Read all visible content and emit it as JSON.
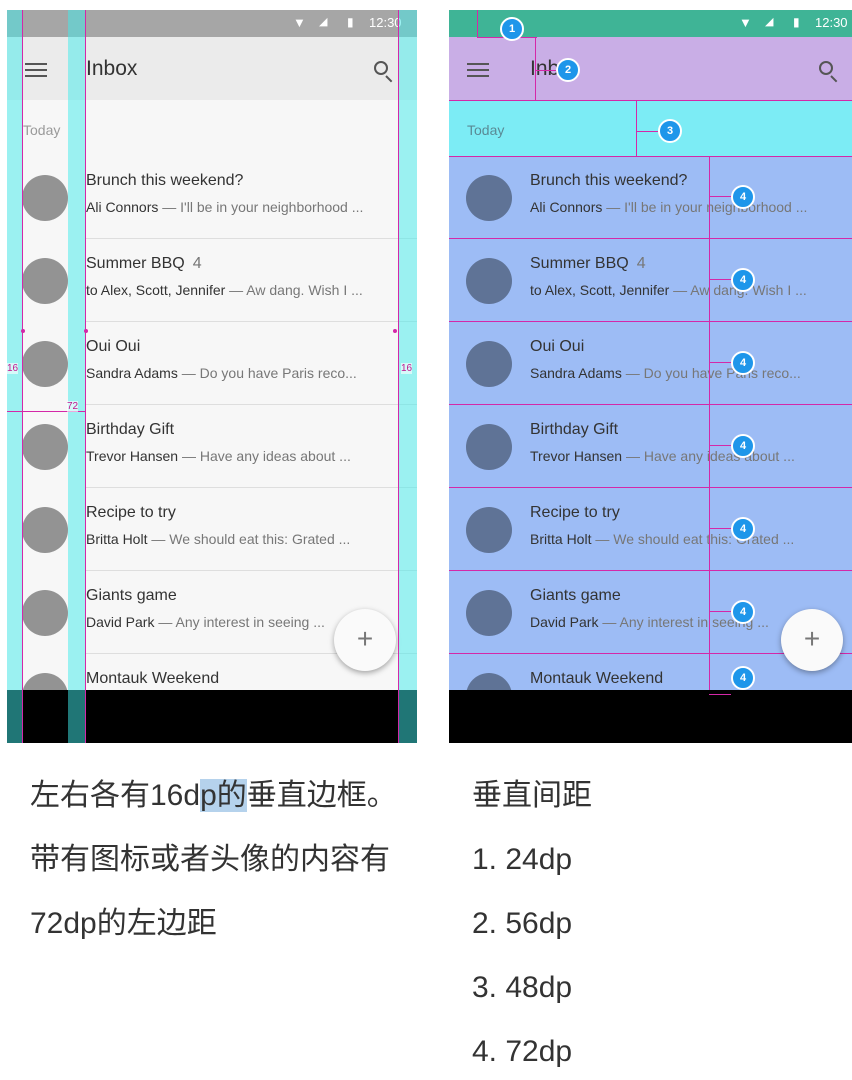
{
  "status": {
    "time": "12:30"
  },
  "appbar": {
    "title_left": "Inbox",
    "title_right": "Inb  x"
  },
  "section": {
    "today": "Today"
  },
  "emails": [
    {
      "subject": "Brunch this weekend?",
      "count": "",
      "sender": "Ali Connors",
      "snippet": " — I'll be in your neighborhood ..."
    },
    {
      "subject": "Summer BBQ",
      "count": "4",
      "sender": "to Alex, Scott, Jennifer",
      "snippet": " — Aw dang. Wish I ..."
    },
    {
      "subject": "Oui Oui",
      "count": "",
      "sender": "Sandra Adams",
      "snippet": " — Do you have Paris reco..."
    },
    {
      "subject": "Birthday Gift",
      "count": "",
      "sender": "Trevor Hansen",
      "snippet": " — Have any ideas about ..."
    },
    {
      "subject": "Recipe to try",
      "count": "",
      "sender": "Britta Holt",
      "snippet": " — We should eat this: Grated ..."
    },
    {
      "subject": "Giants game",
      "count": "",
      "sender": "David Park",
      "snippet": " — Any interest in seeing ..."
    },
    {
      "subject": "Montauk Weekend",
      "count": "",
      "sender": "",
      "snippet": ""
    }
  ],
  "fab": {
    "label": "+"
  },
  "measurements": {
    "left_margin": "16",
    "right_margin": "16",
    "content_left": "72"
  },
  "badges": [
    "1",
    "2",
    "3",
    "4"
  ],
  "caption_left": {
    "part1": "左右各有16d",
    "part2": "p的",
    "part3": "垂直边框。带有图标或者头像的内容有72dp的左边距"
  },
  "caption_right": {
    "title": "垂直间距",
    "items": [
      "1. 24dp",
      "2. 56dp",
      "3. 48dp",
      "4. 72dp"
    ]
  },
  "colors": {
    "cyan_overlay": "#40ebeb",
    "purple_overlay": "#c9aee6",
    "blue_overlay": "#9dbcf5",
    "teal_statusbar": "#3fb496",
    "marker_line": "#d428a8",
    "badge": "#1e96ea"
  }
}
